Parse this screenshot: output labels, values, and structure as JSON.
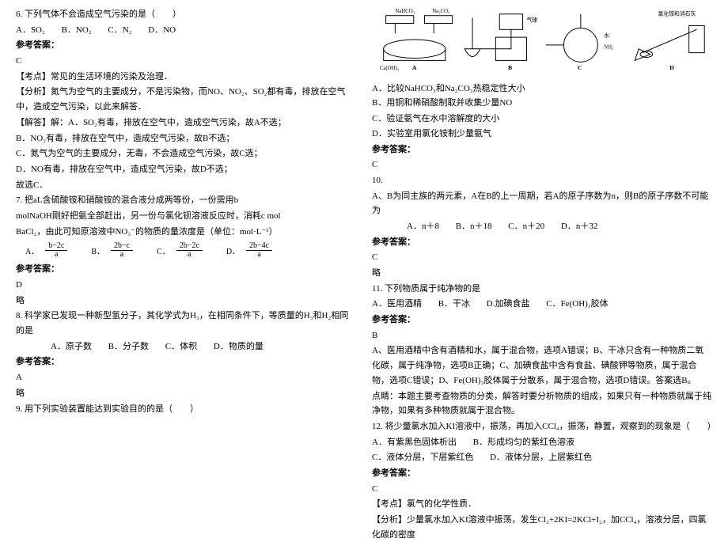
{
  "left": {
    "q6": {
      "stem": "6. 下列气体不会造成空气污染的是（　　）",
      "optA": "A．SO₂",
      "optB": "B．NO₂",
      "optC": "C．N₂",
      "optD": "D．NO",
      "ans_label": "参考答案：",
      "ans": "C",
      "kd": "【考点】常见的生活环境的污染及治理．",
      "fx": "【分析】氮气为空气的主要成分，不是污染物，而NO、NO₂、SO₂都有毒，排放在空气中，造成空气污染，以此来解答．",
      "jd0": "【解答】解：A．SO₂有毒，排放在空气中，造成空气污染，故A不选；",
      "jd1": "B．NO₂有毒，排放在空气中，造成空气污染，故B不选；",
      "jd2": "C．氮气为空气的主要成分，无毒，不会造成空气污染，故C选；",
      "jd3": "D．NO有毒，排放在空气中，造成空气污染，故D不选；",
      "jd4": "故选C．"
    },
    "q7": {
      "l1": "7. 把aL含硫酸铵和硝酸铵的混合液分成两等份，一份需用b",
      "l2": "molNaOH刚好把氨全部赶出，另一份与氯化钡溶液反应时，消耗c mol",
      "l3": "BaCl₂，由此可知原溶液中NO₃⁻的物质的量浓度是（单位：mol·L⁻¹）",
      "fA_top": "b−2c",
      "fA_bot": "a",
      "fB_top": "2b−c",
      "fB_bot": "a",
      "fC_top": "2b−2c",
      "fC_bot": "a",
      "fD_top": "2b−4c",
      "fD_bot": "a",
      "LA": "A．",
      "LB": "B．",
      "LC": "C．",
      "LD": "D．",
      "ans_label": "参考答案：",
      "ans": "D",
      "post": "略"
    },
    "q8": {
      "stem": "8. 科学家已发现一种新型氢分子，其化学式为H₃，在相同条件下，等质量的H₃和H₂相同的是",
      "optA": "A．原子数",
      "optB": "B．分子数",
      "optC": "C．体积",
      "optD": "D．物质的量",
      "ans_label": "参考答案：",
      "ans": "A",
      "post": "略"
    },
    "q9": {
      "stem": "9. 用下列实验装置能达到实验目的的是（　　）"
    }
  },
  "right": {
    "diag": {
      "nahco3": "NaHCO₃",
      "na2co3": "Na₂CO₃",
      "qiqiu": "气球",
      "water": "水",
      "nh3": "NH₃",
      "cacoh2": "Ca(OH)₂",
      "A": "A",
      "B": "B",
      "C": "C",
      "D": "D",
      "nhcl": "氯化铵和消石灰"
    },
    "q9opts": {
      "A": "A．比较NaHCO₃和Na₂CO₃热稳定性大小",
      "B": "B．用铜和稀硝酸制取并收集少量NO",
      "C": "C．验证氨气在水中溶解度的大小",
      "D": "D．实验室用氯化铵制少量氨气",
      "ans_label": "参考答案：",
      "ans": "C"
    },
    "q10": {
      "num": "10.",
      "stem": "A、B为同主族的两元素，A在B的上一周期，若A的原子序数为n，则B的原子序数不可能为",
      "optA": "A．n＋8",
      "optB": "B．n＋18",
      "optC": "C．n＋20",
      "optD": "D．n＋32",
      "ans_label": "参考答案：",
      "ans": "C",
      "post": "略"
    },
    "q11": {
      "stem": "11. 下列物质属于纯净物的是",
      "optA": "A．医用酒精",
      "optB": "B．干冰",
      "optD": "D.加碘食盐",
      "optC": "C．Fe(OH)₃胶体",
      "ans_label": "参考答案：",
      "ans": "B",
      "e1": "A、医用酒精中含有酒精和水，属于混合物，选项A错误；B、干冰只含有一种物质二氧化碳，属于纯净物，选项B正确；C、加碘食盐中含有食盐、碘酸钾等物质，属于混合物，选项C错误；D、Fe(OH)₃胶体属于分散系，属于混合物，选项D错误。答案选B。",
      "e2": "点睛：本题主要考查物质的分类，解答时要分析物质的组成，如果只有一种物质就属于纯净物，如果有多种物质就属于混合物。"
    },
    "q12": {
      "stem": "12. 将少量氯水加入KI溶液中，振荡，再加入CCl₄，振荡，静置，观察到的现象是（　　）",
      "A": "A．有紫黑色固体析出",
      "B": "B．形成均匀的紫红色溶液",
      "C": "C．液体分层，下层紫红色",
      "D": "D．液体分层，上层紫红色",
      "ans_label": "参考答案：",
      "ans": "C",
      "kd": "【考点】氯气的化学性质．",
      "fx": "【分析】少量氯水加入KI溶液中振荡，发生Cl₂+2KI=2KCl+I₂，加CCl₄，溶液分层，四氯化碳的密度"
    }
  }
}
